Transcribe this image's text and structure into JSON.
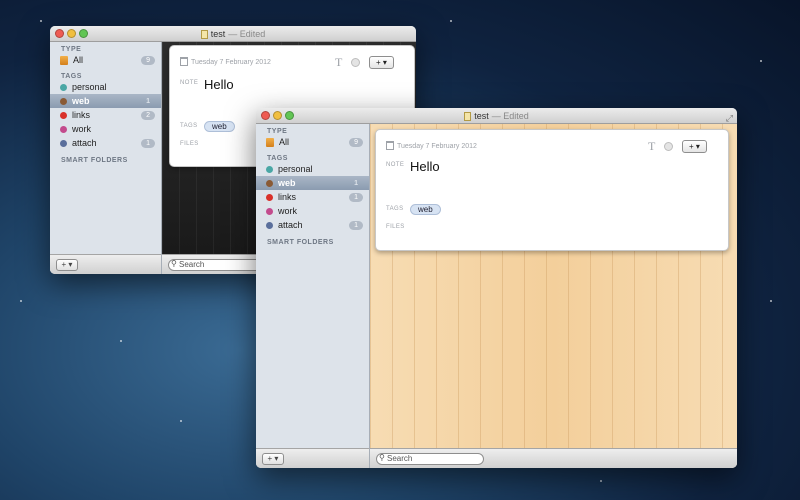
{
  "windows": {
    "back": {
      "title": "test",
      "edited": "— Edited",
      "type_header": "TYPE",
      "all_label": "All",
      "all_count": "9",
      "tags_header": "TAGS",
      "tags": [
        {
          "label": "personal",
          "color": "#4aa7a5",
          "count": ""
        },
        {
          "label": "web",
          "color": "#8a5a35",
          "count": "1",
          "selected": true
        },
        {
          "label": "links",
          "color": "#d9312a",
          "count": "2"
        },
        {
          "label": "work",
          "color": "#c34b8d",
          "count": ""
        },
        {
          "label": "attach",
          "color": "#5a6f9c",
          "count": "1"
        }
      ],
      "smart_header": "SMART FOLDERS",
      "add_label": "+ ▾",
      "search_placeholder": "Search",
      "note": {
        "date": "Tuesday 7 February 2012",
        "note_label": "NOTE",
        "text": "Hello",
        "tags_label": "TAGS",
        "tag": "web",
        "files_label": "FILES",
        "t_tool": "T",
        "add_tool": "+ ▾"
      }
    },
    "front": {
      "title": "test",
      "edited": "— Edited",
      "type_header": "TYPE",
      "all_label": "All",
      "all_count": "9",
      "tags_header": "TAGS",
      "tags": [
        {
          "label": "personal",
          "color": "#4aa7a5",
          "count": ""
        },
        {
          "label": "web",
          "color": "#8a5a35",
          "count": "1",
          "selected": true
        },
        {
          "label": "links",
          "color": "#d9312a",
          "count": "1"
        },
        {
          "label": "work",
          "color": "#c34b8d",
          "count": ""
        },
        {
          "label": "attach",
          "color": "#5a6f9c",
          "count": "1"
        }
      ],
      "smart_header": "SMART FOLDERS",
      "add_label": "+ ▾",
      "search_placeholder": "Search",
      "note": {
        "date": "Tuesday 7 February 2012",
        "note_label": "NOTE",
        "text": "Hello",
        "tags_label": "TAGS",
        "tag": "web",
        "files_label": "FILES",
        "t_tool": "T",
        "add_tool": "+ ▾"
      }
    }
  }
}
